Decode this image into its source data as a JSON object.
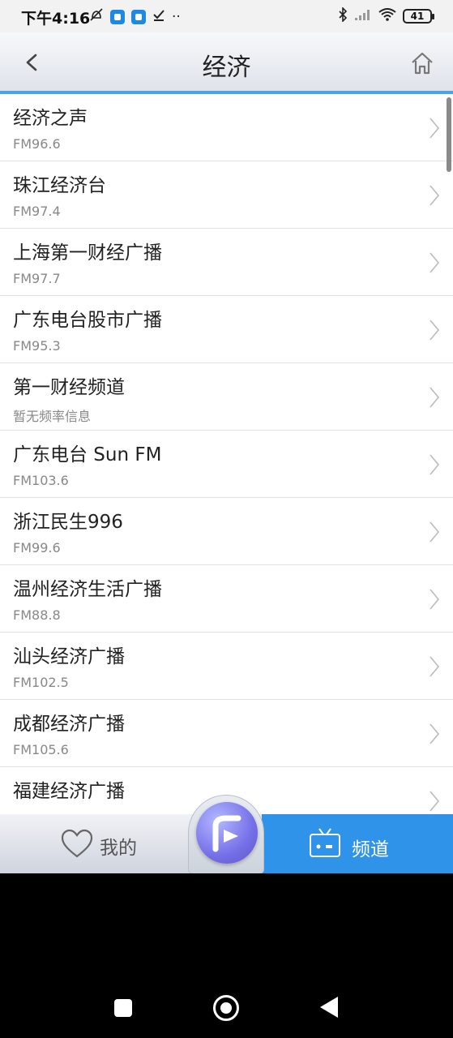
{
  "status_bar": {
    "time": "下午4:16",
    "battery": "41",
    "dots": "··"
  },
  "header": {
    "title": "经济",
    "back_icon": "chevron-left-icon",
    "home_icon": "home-icon"
  },
  "stations": [
    {
      "name": "经济之声",
      "freq": "FM96.6"
    },
    {
      "name": "珠江经济台",
      "freq": "FM97.4"
    },
    {
      "name": "上海第一财经广播",
      "freq": "FM97.7"
    },
    {
      "name": "广东电台股市广播",
      "freq": "FM95.3"
    },
    {
      "name": "第一财经频道",
      "freq": "暂无频率信息"
    },
    {
      "name": "广东电台 Sun FM",
      "freq": "FM103.6"
    },
    {
      "name": "浙江民生996",
      "freq": "FM99.6"
    },
    {
      "name": "温州经济生活广播",
      "freq": "FM88.8"
    },
    {
      "name": "汕头经济广播",
      "freq": "FM102.5"
    },
    {
      "name": "成都经济广播",
      "freq": "FM105.6"
    },
    {
      "name": "福建经济广播",
      "freq": ""
    }
  ],
  "tabbar": {
    "mine_label": "我的",
    "channel_label": "频道",
    "active_color": "#2f93ea"
  },
  "colors": {
    "accent": "#4aa3e8"
  }
}
